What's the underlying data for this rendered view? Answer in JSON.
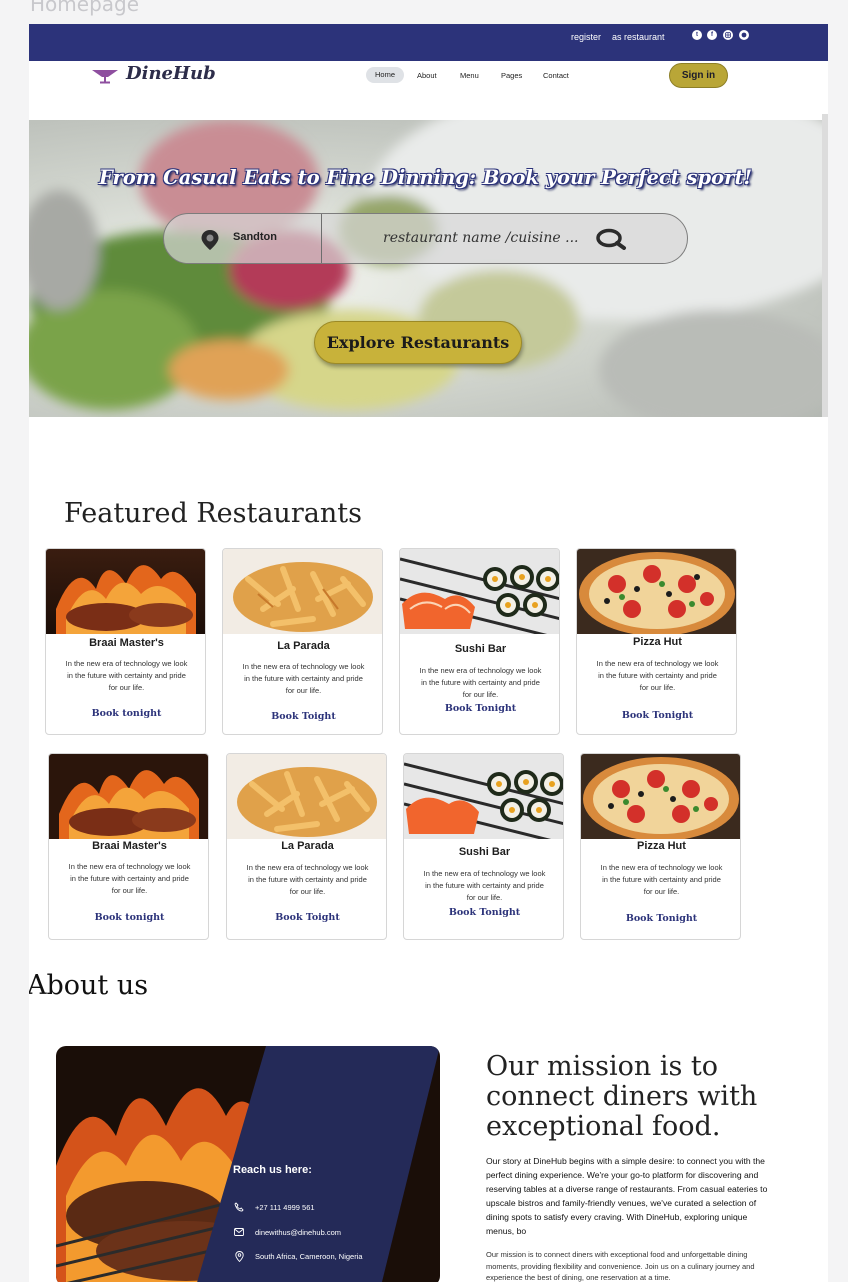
{
  "frame_label": "Homepage",
  "topbar": {
    "register_label": "register",
    "restaurant_label": "as restaurant",
    "social_icons": [
      "twitter-icon",
      "facebook-icon",
      "instagram-icon",
      "github-icon"
    ]
  },
  "nav": {
    "brand": "DineHub",
    "items": [
      "Home",
      "About",
      "Menu",
      "Pages",
      "Contact"
    ],
    "active": "Home",
    "signin_label": "Sign in"
  },
  "hero": {
    "title": "From Casual Eats to Fine Dinning: Book your Perfect sport!",
    "location": "Sandton",
    "search_placeholder": "restaurant name /cuisine ...",
    "explore_label": "Explore Restaurants"
  },
  "featured": {
    "title": "Featured Restaurants",
    "row1": [
      {
        "name": "Braai Master's",
        "desc": "In the new era of technology we look in the future with certainty and pride for our life.",
        "book": "Book tonight"
      },
      {
        "name": "La Parada",
        "desc": "In the new era of technology we look in the future with certainty and pride for our life.",
        "book": "Book  Toight"
      },
      {
        "name": "Sushi  Bar",
        "desc": "In the new era of technology we look in the future with certainty and pride for our life.",
        "book": "Book Tonight"
      },
      {
        "name": "Pizza Hut",
        "desc": "In the new era of technology we look in the future with certainty and pride for our life.",
        "book": "Book  Tonight"
      }
    ],
    "row2": [
      {
        "name": "Braai Master's",
        "desc": "In the new era of technology we look in the future with certainty and pride for our life.",
        "book": "Book tonight"
      },
      {
        "name": "La Parada",
        "desc": "In the new era of technology we look in the future with certainty and pride for our life.",
        "book": "Book  Toight"
      },
      {
        "name": "Sushi  Bar",
        "desc": "In the new era of technology we look in the future with certainty and pride for our life.",
        "book": "Book Tonight"
      },
      {
        "name": "Pizza Hut",
        "desc": "In the new era of technology we look in the future with certainty and pride for our life.",
        "book": "Book  Tonight"
      }
    ]
  },
  "about": {
    "title": "About us",
    "reach_title": "Reach us here:",
    "phone": "+27 111 4999 561",
    "email": "dinewithus@dinehub.com",
    "location": "South Africa, Cameroon, Nigeria",
    "mission_title": "Our mission is to connect diners with exceptional food.",
    "story": "Our story at DineHub begins with a simple desire: to connect you with the perfect dining experience. We're your go-to platform for discovering and reserving tables at a diverse range of restaurants. From casual eateries to upscale bistros and family-friendly venues, we've curated a selection of dining spots to satisfy every craving. With DineHub, exploring unique menus, bo",
    "mission_text": "Our mission is to connect diners with exceptional food and unforgettable dining moments, providing flexibility and convenience. Join us on a culinary journey and experience the best of dining, one reservation at a time."
  },
  "colors": {
    "navy": "#2c337a",
    "gold": "#c8b23a",
    "logo_purple": "#8e4f9f"
  }
}
